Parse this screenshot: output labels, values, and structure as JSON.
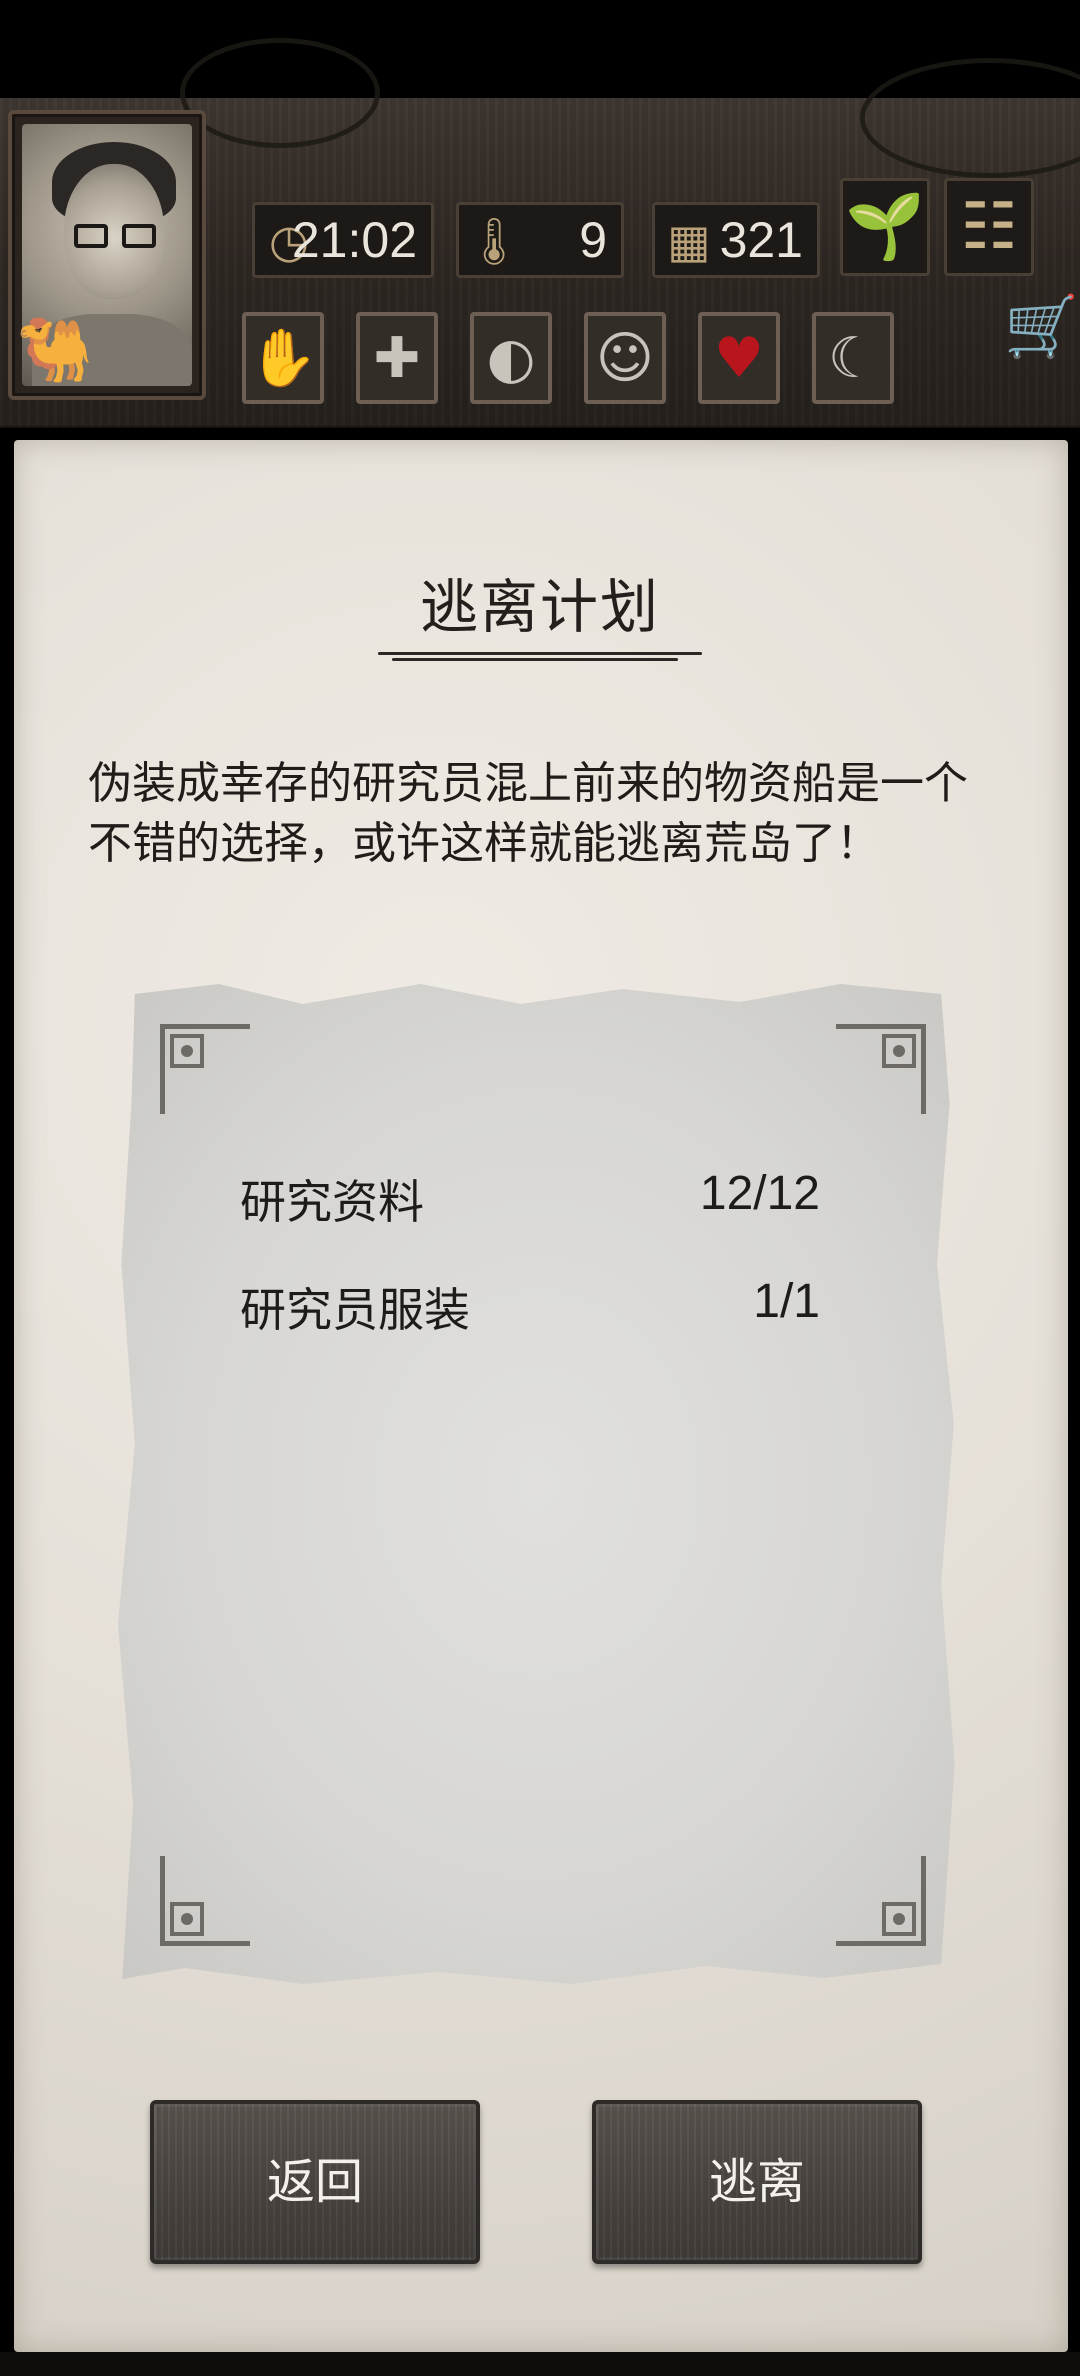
{
  "header": {
    "time": "21:02",
    "temperature": "9",
    "day": "321",
    "icons": {
      "time": "clock-icon",
      "temperature": "thermometer-icon",
      "day": "calendar-icon",
      "plant": "sprout-icon",
      "menu": "menu-icon",
      "cart": "shopping-cart-icon"
    },
    "status_icons": [
      "bandaged-hand-icon",
      "health-cross-icon",
      "stomach-icon",
      "head-mood-icon",
      "heart-icon",
      "moon-sleep-icon"
    ]
  },
  "dialog": {
    "title": "逃离计划",
    "description": "伪装成幸存的研究员混上前来的物资船是一个不错的选择，或许这样就能逃离荒岛了！",
    "requirements": [
      {
        "label": "研究资料",
        "value": "12/12"
      },
      {
        "label": "研究员服装",
        "value": "1/1"
      }
    ]
  },
  "buttons": {
    "back": "返回",
    "escape": "逃离"
  },
  "colors": {
    "heart_status": "#b8161c",
    "header_wood": "#2f2823",
    "parchment": "#e5e0d8"
  }
}
